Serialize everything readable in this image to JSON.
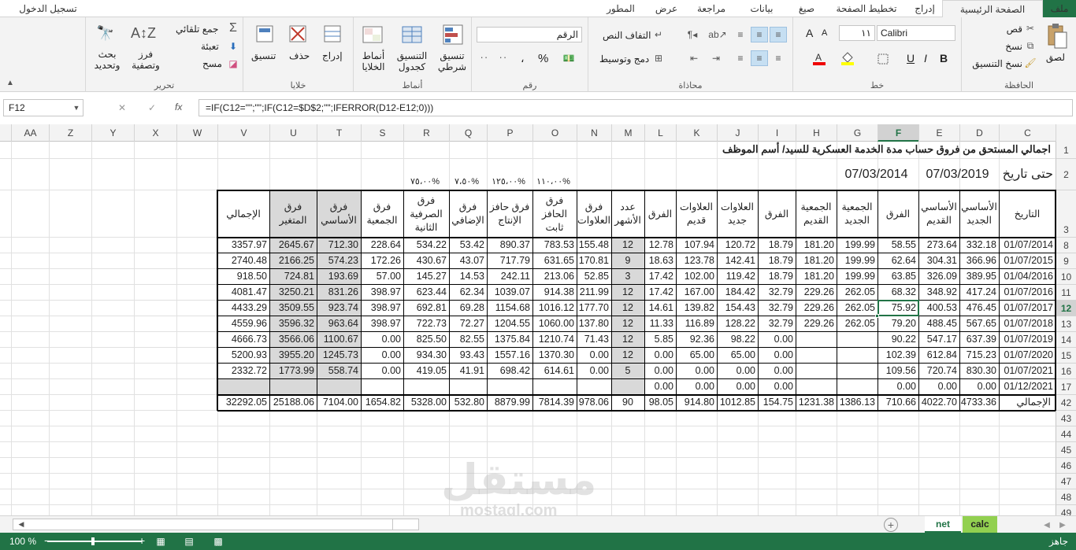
{
  "tabs": {
    "file": "ملف",
    "home": "الصفحة الرئيسية",
    "insert": "إدراج",
    "layout": "تخطيط الصفحة",
    "formulas": "صيغ",
    "data": "بيانات",
    "review": "مراجعة",
    "view": "عرض",
    "developer": "المطور",
    "signin": "تسجيل الدخول"
  },
  "ribbon": {
    "clipboard": {
      "label": "الحافظة",
      "paste": "لصق",
      "cut": "قص",
      "copy": "نسخ",
      "format_painter": "نسخ التنسيق"
    },
    "font": {
      "label": "خط",
      "name": "Calibri",
      "size": "١١",
      "bold": "B",
      "italic": "I",
      "underline": "U"
    },
    "alignment": {
      "label": "محاذاة",
      "wrap": "التفاف النص",
      "merge": "دمج وتوسيط"
    },
    "number": {
      "label": "رقم",
      "format": "الرقم",
      "percent": "%",
      "comma": "،",
      "inc": "٠٠",
      "dec": "٠٠"
    },
    "styles": {
      "label": "أنماط",
      "conditional": "تنسيق شرطي",
      "as_table": "التنسيق كجدول",
      "cell_styles": "أنماط الخلايا"
    },
    "cells": {
      "label": "خلايا",
      "insert": "إدراج",
      "delete": "حذف",
      "format": "تنسيق"
    },
    "editing": {
      "label": "تحرير",
      "autosum": "جمع تلقائي",
      "fill": "تعبئة",
      "clear": "مسح",
      "sort": "فرز وتصفية",
      "find": "بحث وتحديد"
    }
  },
  "formula_bar": {
    "name_box": "F12",
    "fx": "fx",
    "formula": "=IF(C12=\"\";\"\";IF(C12=$D$2;\"\";IFERROR(D12-E12;0)))"
  },
  "columns": [
    "C",
    "D",
    "E",
    "F",
    "G",
    "H",
    "I",
    "J",
    "K",
    "L",
    "M",
    "N",
    "O",
    "P",
    "Q",
    "R",
    "S",
    "T",
    "U",
    "V",
    "W",
    "X",
    "Y",
    "Z",
    "AA"
  ],
  "rows": [
    "1",
    "2",
    "3",
    "8",
    "9",
    "10",
    "11",
    "12",
    "13",
    "14",
    "15",
    "16",
    "17",
    "42",
    "43",
    "44",
    "45",
    "46",
    "47",
    "48",
    "49"
  ],
  "sheet": {
    "title": "اجمالي المستحق من فروق حساب مدة الخدمة العسكرية للسيد/ أسم الموظف",
    "until_label": "حتى تاريخ",
    "d2": "07/03/2019",
    "f2": "07/03/2014",
    "percents": {
      "O": "%١١٠،٠٠",
      "P": "%١٢٥،٠٠",
      "Q": "%٧،٥٠",
      "R": "%٧٥،٠٠"
    },
    "headers": [
      "التاريخ",
      "الأساسي الجديد",
      "الأساسي القديم",
      "الفرق",
      "الجمعية الجديد",
      "الجمعية القديم",
      "الفرق",
      "العلاوات جديد",
      "العلاوات قديم",
      "الفرق",
      "عدد الأشهر",
      "فرق العلاوات",
      "فرق الحافز ثابت",
      "فرق حافز الإنتاج",
      "فرق الإضافي",
      "فرق الصرفية الثانية",
      "فرق الجمعية",
      "فرق الأساسي",
      "فرق المتغير",
      "الإجمالي"
    ],
    "data": [
      [
        "01/07/2014",
        "332.18",
        "273.64",
        "58.55",
        "199.99",
        "181.20",
        "18.79",
        "120.72",
        "107.94",
        "12.78",
        "12",
        "155.48",
        "783.53",
        "890.37",
        "53.42",
        "534.22",
        "228.64",
        "712.30",
        "2645.67",
        "3357.97"
      ],
      [
        "01/07/2015",
        "366.96",
        "304.31",
        "62.64",
        "199.99",
        "181.20",
        "18.79",
        "142.41",
        "123.78",
        "18.63",
        "9",
        "170.81",
        "631.65",
        "717.79",
        "43.07",
        "430.67",
        "172.26",
        "574.23",
        "2166.25",
        "2740.48"
      ],
      [
        "01/04/2016",
        "389.95",
        "326.09",
        "63.85",
        "199.99",
        "181.20",
        "18.79",
        "119.42",
        "102.00",
        "17.42",
        "3",
        "52.85",
        "213.06",
        "242.11",
        "14.53",
        "145.27",
        "57.00",
        "193.69",
        "724.81",
        "918.50"
      ],
      [
        "01/07/2016",
        "417.24",
        "348.92",
        "68.32",
        "262.05",
        "229.26",
        "32.79",
        "184.42",
        "167.00",
        "17.42",
        "12",
        "211.99",
        "914.38",
        "1039.07",
        "62.34",
        "623.44",
        "398.97",
        "831.26",
        "3250.21",
        "4081.47"
      ],
      [
        "01/07/2017",
        "476.45",
        "400.53",
        "75.92",
        "262.05",
        "229.26",
        "32.79",
        "154.43",
        "139.82",
        "14.61",
        "12",
        "177.70",
        "1016.12",
        "1154.68",
        "69.28",
        "692.81",
        "398.97",
        "923.74",
        "3509.55",
        "4433.29"
      ],
      [
        "01/07/2018",
        "567.65",
        "488.45",
        "79.20",
        "262.05",
        "229.26",
        "32.79",
        "128.22",
        "116.89",
        "11.33",
        "12",
        "137.80",
        "1060.00",
        "1204.55",
        "72.27",
        "722.73",
        "398.97",
        "963.64",
        "3596.32",
        "4559.96"
      ],
      [
        "01/07/2019",
        "637.39",
        "547.17",
        "90.22",
        "",
        "",
        "0.00",
        "98.22",
        "92.36",
        "5.85",
        "12",
        "71.43",
        "1210.74",
        "1375.84",
        "82.55",
        "825.50",
        "0.00",
        "1100.67",
        "3566.06",
        "4666.73"
      ],
      [
        "01/07/2020",
        "715.23",
        "612.84",
        "102.39",
        "",
        "",
        "0.00",
        "65.00",
        "65.00",
        "0.00",
        "12",
        "0.00",
        "1370.30",
        "1557.16",
        "93.43",
        "934.30",
        "0.00",
        "1245.73",
        "3955.20",
        "5200.93"
      ],
      [
        "01/07/2021",
        "830.30",
        "720.74",
        "109.56",
        "",
        "",
        "0.00",
        "0.00",
        "0.00",
        "0.00",
        "5",
        "0.00",
        "614.61",
        "698.42",
        "41.91",
        "419.05",
        "0.00",
        "558.74",
        "1773.99",
        "2332.72"
      ],
      [
        "01/12/2021",
        "0.00",
        "0.00",
        "0.00",
        "",
        "",
        "0.00",
        "0.00",
        "0.00",
        "0.00",
        "",
        "",
        "",
        "",
        "",
        "",
        "",
        "",
        "",
        ""
      ]
    ],
    "total": [
      "الإجمالي",
      "4733.36",
      "4022.70",
      "710.66",
      "1386.13",
      "1231.38",
      "154.75",
      "1012.85",
      "914.80",
      "98.05",
      "90",
      "978.06",
      "7814.39",
      "8879.99",
      "532.80",
      "5328.00",
      "1654.82",
      "7104.00",
      "25188.06",
      "32292.05"
    ]
  },
  "sheets": {
    "calc": "calc",
    "net": "net"
  },
  "status": {
    "ready": "جاهز",
    "zoom": "100 %"
  },
  "watermark": {
    "arabic": "مستقل",
    "latin": "mostaql.com"
  }
}
